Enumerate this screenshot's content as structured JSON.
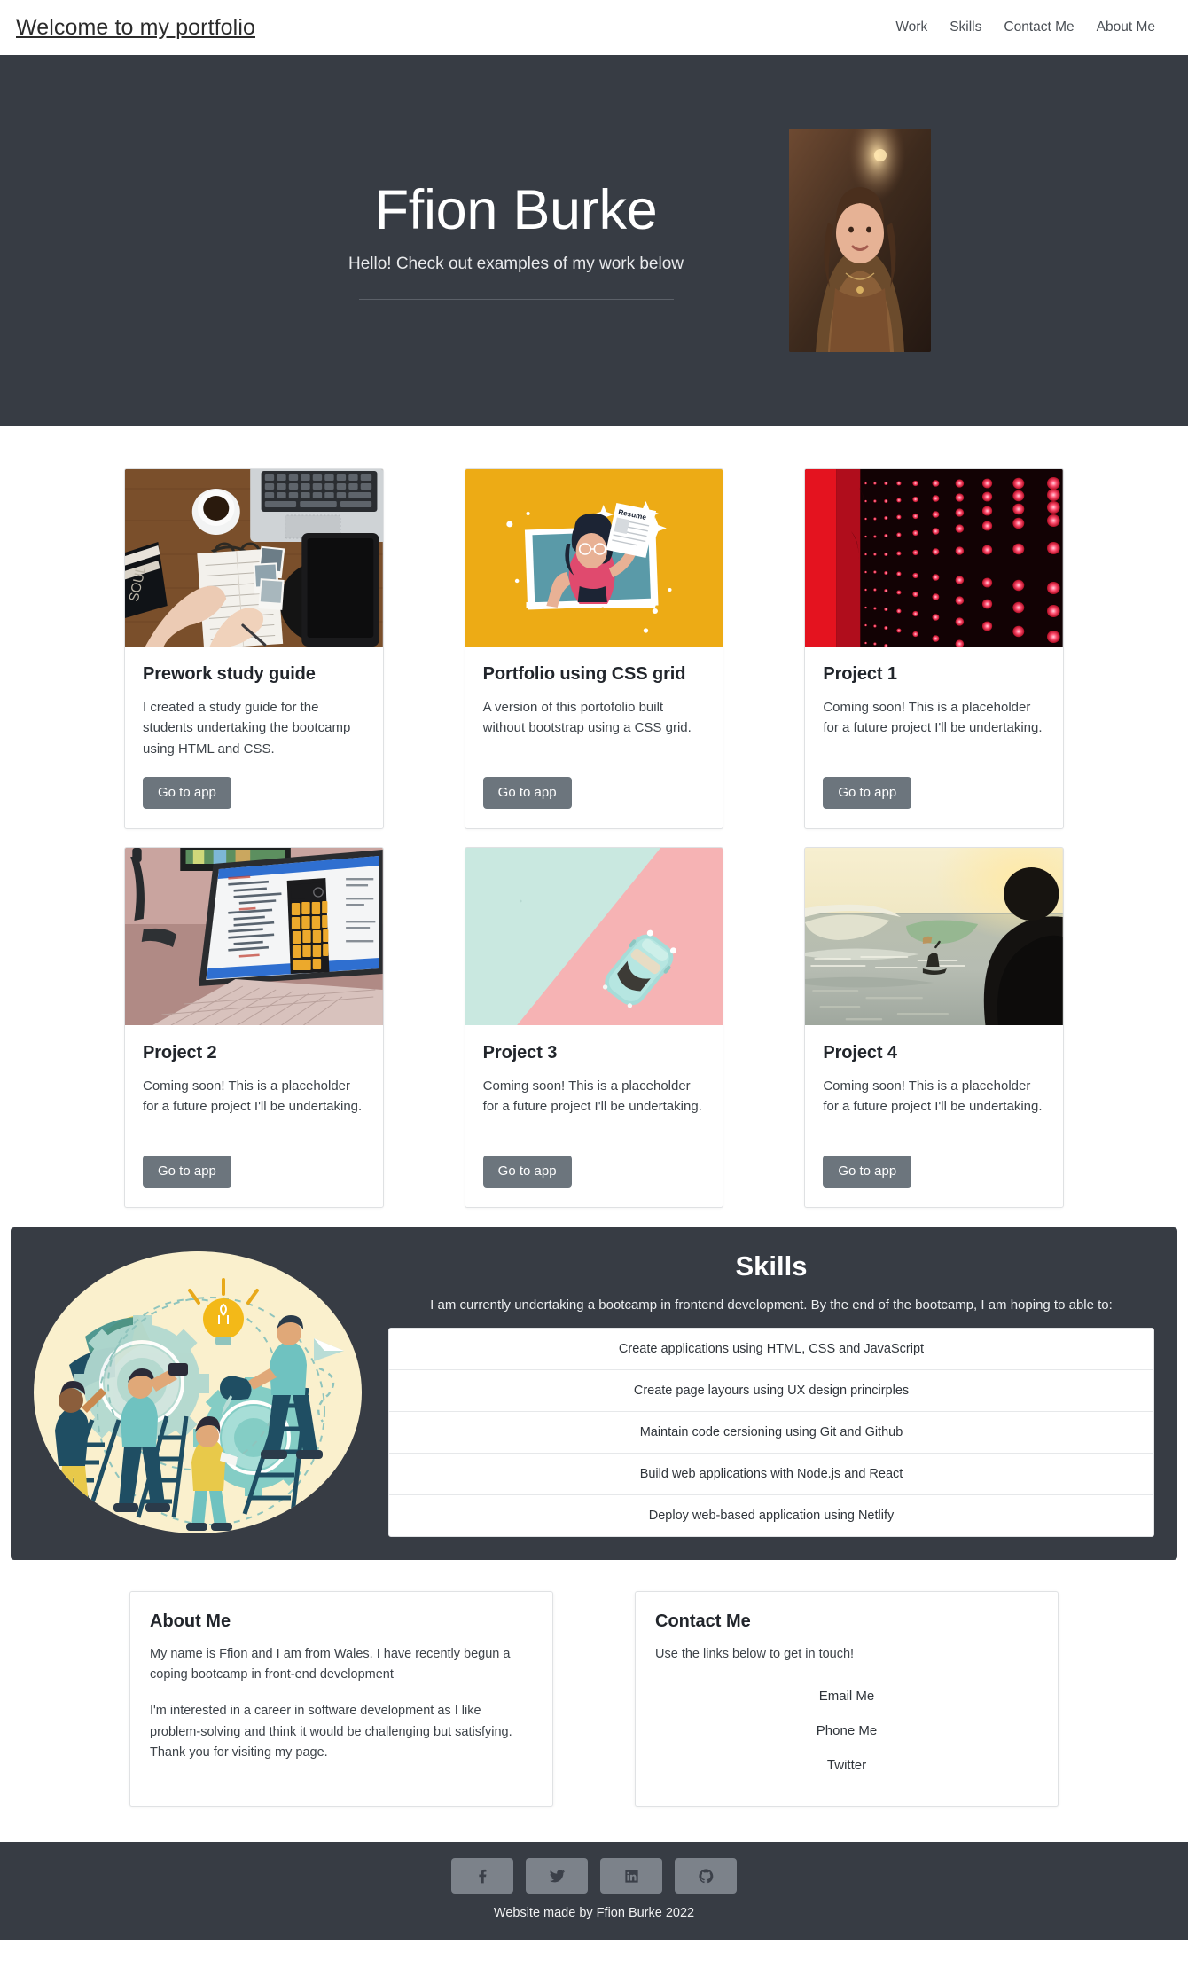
{
  "nav": {
    "brand": "Welcome to my portfolio",
    "links": [
      {
        "label": "Work"
      },
      {
        "label": "Skills"
      },
      {
        "label": "Contact Me"
      },
      {
        "label": "About Me"
      }
    ]
  },
  "hero": {
    "title": "Ffion Burke",
    "subtitle": "Hello! Check out examples of my work below",
    "portrait_alt": "portrait-photo"
  },
  "work": {
    "cards": [
      {
        "title": "Prework study guide",
        "text": "I created a study guide for the students undertaking the bootcamp using HTML and CSS.",
        "button": "Go to app",
        "image": "desk-with-laptop-coffee-notebook"
      },
      {
        "title": "Portfolio using CSS grid",
        "text": "A version of this portofolio built without bootstrap using a CSS grid.",
        "button": "Go to app",
        "image": "illustration-woman-holding-resume"
      },
      {
        "title": "Project 1",
        "text": "Coming soon! This is a placeholder for a future project I'll be undertaking.",
        "button": "Go to app",
        "image": "red-led-matrix-perspective"
      },
      {
        "title": "Project 2",
        "text": "Coming soon! This is a placeholder for a future project I'll be undertaking.",
        "button": "Go to app",
        "image": "laptop-showing-calculator-code"
      },
      {
        "title": "Project 3",
        "text": "Coming soon! This is a placeholder for a future project I'll be undertaking.",
        "button": "Go to app",
        "image": "pastel-toy-car-on-split-background"
      },
      {
        "title": "Project 4",
        "text": "Coming soon! This is a placeholder for a future project I'll be undertaking.",
        "button": "Go to app",
        "image": "surfer-sunset-silhouette"
      }
    ]
  },
  "skills": {
    "illustration": "teamwork-gears-lightbulb-illustration",
    "title": "Skills",
    "lead": "I am currently undertaking a bootcamp in frontend development. By the end of the bootcamp, I am hoping to able to:",
    "items": [
      "Create applications using HTML, CSS and JavaScript",
      "Create page layours using UX design princirples",
      "Maintain code cersioning using Git and Github",
      "Build web applications with Node.js and React",
      "Deploy web-based application using Netlify"
    ]
  },
  "about": {
    "title": "About Me",
    "paragraph1": "My name is Ffion and I am from Wales. I have recently begun a coping bootcamp in front-end development",
    "paragraph2": "I'm interested in a career in software development as I like problem-solving and think it would be challenging but satisfying. Thank you for visiting my page."
  },
  "contact": {
    "title": "Contact Me",
    "lead": "Use the links below to get in touch!",
    "links": [
      {
        "label": "Email Me"
      },
      {
        "label": "Phone Me"
      },
      {
        "label": "Twitter"
      }
    ]
  },
  "footer": {
    "socials": [
      {
        "name": "facebook"
      },
      {
        "name": "twitter"
      },
      {
        "name": "linkedin"
      },
      {
        "name": "github"
      }
    ],
    "copyright": "Website made by Ffion Burke 2022"
  },
  "colors": {
    "dark": "#373c44",
    "button_gray": "#6c757d",
    "social_gray": "#7c828a",
    "card_yellow": "#EDAB15",
    "card_red": "#E4131F"
  }
}
